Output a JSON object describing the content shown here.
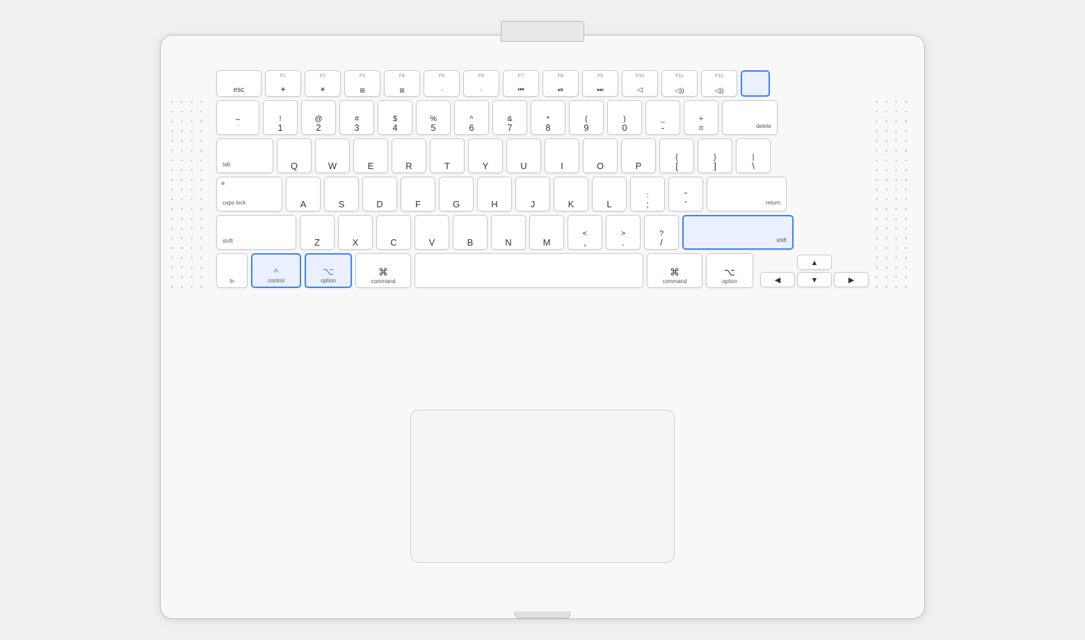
{
  "keyboard": {
    "rows": {
      "fn_row": [
        {
          "id": "esc",
          "label": "esc",
          "width": "esc"
        },
        {
          "id": "f1",
          "symbol": "☀",
          "sublabel": "F1",
          "width": "fn"
        },
        {
          "id": "f2",
          "symbol": "☀",
          "sublabel": "F2",
          "width": "fn"
        },
        {
          "id": "f3",
          "symbol": "⊞",
          "sublabel": "F3",
          "width": "fn"
        },
        {
          "id": "f4",
          "symbol": "⊞",
          "sublabel": "F4",
          "width": "fn"
        },
        {
          "id": "f5",
          "symbol": "·",
          "sublabel": "F5",
          "width": "fn"
        },
        {
          "id": "f6",
          "symbol": "·",
          "sublabel": "F6",
          "width": "fn"
        },
        {
          "id": "f7",
          "symbol": "⏮",
          "sublabel": "F7",
          "width": "fn"
        },
        {
          "id": "f8",
          "symbol": "⏯",
          "sublabel": "F8",
          "width": "fn"
        },
        {
          "id": "f9",
          "symbol": "⏭",
          "sublabel": "F9",
          "width": "fn"
        },
        {
          "id": "f10",
          "symbol": "◁",
          "sublabel": "F10",
          "width": "fn"
        },
        {
          "id": "f11",
          "symbol": "◁",
          "sublabel": "F11",
          "width": "fn"
        },
        {
          "id": "f12",
          "symbol": "◁",
          "sublabel": "F12",
          "width": "fn"
        },
        {
          "id": "power",
          "label": "",
          "width": "power",
          "highlighted": true
        }
      ],
      "row1": [
        {
          "id": "tilde",
          "top": "~",
          "bottom": "`",
          "width": "std"
        },
        {
          "id": "1",
          "top": "!",
          "bottom": "1",
          "width": "std"
        },
        {
          "id": "2",
          "top": "@",
          "bottom": "2",
          "width": "std"
        },
        {
          "id": "3",
          "top": "#",
          "bottom": "3",
          "width": "std"
        },
        {
          "id": "4",
          "top": "$",
          "bottom": "4",
          "width": "std"
        },
        {
          "id": "5",
          "top": "%",
          "bottom": "5",
          "width": "std"
        },
        {
          "id": "6",
          "top": "^",
          "bottom": "6",
          "width": "std"
        },
        {
          "id": "7",
          "top": "&",
          "bottom": "7",
          "width": "std"
        },
        {
          "id": "8",
          "top": "*",
          "bottom": "8",
          "width": "std"
        },
        {
          "id": "9",
          "top": "(",
          "bottom": "9",
          "width": "std"
        },
        {
          "id": "0",
          "top": ")",
          "bottom": "0",
          "width": "std"
        },
        {
          "id": "minus",
          "top": "_",
          "bottom": "-",
          "width": "std"
        },
        {
          "id": "equal",
          "top": "+",
          "bottom": "=",
          "width": "std"
        },
        {
          "id": "delete",
          "label": "delete",
          "width": "delete"
        }
      ],
      "row2": [
        {
          "id": "tab",
          "label": "tab",
          "width": "tab"
        },
        {
          "id": "q",
          "label": "Q",
          "width": "std"
        },
        {
          "id": "w",
          "label": "W",
          "width": "std"
        },
        {
          "id": "e",
          "label": "E",
          "width": "std"
        },
        {
          "id": "r",
          "label": "R",
          "width": "std"
        },
        {
          "id": "t",
          "label": "T",
          "width": "std"
        },
        {
          "id": "y",
          "label": "Y",
          "width": "std"
        },
        {
          "id": "u",
          "label": "U",
          "width": "std"
        },
        {
          "id": "i",
          "label": "I",
          "width": "std"
        },
        {
          "id": "o",
          "label": "O",
          "width": "std"
        },
        {
          "id": "p",
          "label": "P",
          "width": "std"
        },
        {
          "id": "lbrace",
          "top": "{",
          "bottom": "[",
          "width": "std"
        },
        {
          "id": "rbrace",
          "top": "}",
          "bottom": "]",
          "width": "std"
        },
        {
          "id": "pipe",
          "top": "|",
          "bottom": "\\",
          "width": "std"
        }
      ],
      "row3": [
        {
          "id": "capslock",
          "label": "caps lock",
          "width": "caps"
        },
        {
          "id": "a",
          "label": "A",
          "width": "std"
        },
        {
          "id": "s",
          "label": "S",
          "width": "std"
        },
        {
          "id": "d",
          "label": "D",
          "width": "std"
        },
        {
          "id": "f",
          "label": "F",
          "width": "std"
        },
        {
          "id": "g",
          "label": "G",
          "width": "std"
        },
        {
          "id": "h",
          "label": "H",
          "width": "std"
        },
        {
          "id": "j",
          "label": "J",
          "width": "std"
        },
        {
          "id": "k",
          "label": "K",
          "width": "std"
        },
        {
          "id": "l",
          "label": "L",
          "width": "std"
        },
        {
          "id": "semicolon",
          "top": ":",
          "bottom": ";",
          "width": "std"
        },
        {
          "id": "quote",
          "top": "\"",
          "bottom": "'",
          "width": "std"
        },
        {
          "id": "return",
          "label": "return",
          "width": "return"
        }
      ],
      "row4": [
        {
          "id": "shift_l",
          "label": "shift",
          "width": "shift-l"
        },
        {
          "id": "z",
          "label": "Z",
          "width": "std"
        },
        {
          "id": "x",
          "label": "X",
          "width": "std"
        },
        {
          "id": "c",
          "label": "C",
          "width": "std"
        },
        {
          "id": "v",
          "label": "V",
          "width": "std"
        },
        {
          "id": "b",
          "label": "B",
          "width": "std"
        },
        {
          "id": "n",
          "label": "N",
          "width": "std"
        },
        {
          "id": "m",
          "label": "M",
          "width": "std"
        },
        {
          "id": "lt",
          "top": "<",
          "bottom": ",",
          "width": "std"
        },
        {
          "id": "gt",
          "top": ">",
          "bottom": ".",
          "width": "std"
        },
        {
          "id": "question",
          "top": "?",
          "bottom": "/",
          "width": "std"
        },
        {
          "id": "shift_r",
          "label": "shift",
          "width": "shift-r",
          "highlighted": true
        }
      ],
      "row5": [
        {
          "id": "fn",
          "label": "fn",
          "width": "fn-key"
        },
        {
          "id": "control",
          "symbol": "^",
          "label": "control",
          "width": "control",
          "highlighted": true
        },
        {
          "id": "option_l",
          "symbol": "⌥",
          "label": "option",
          "width": "option-l",
          "highlighted": true
        },
        {
          "id": "command_l",
          "symbol": "⌘",
          "label": "command",
          "width": "command-l"
        },
        {
          "id": "space",
          "label": "",
          "width": "space"
        },
        {
          "id": "command_r",
          "symbol": "⌘",
          "label": "command",
          "width": "command-r"
        },
        {
          "id": "option_r",
          "symbol": "⌥",
          "label": "option",
          "width": "option-r"
        }
      ]
    }
  }
}
